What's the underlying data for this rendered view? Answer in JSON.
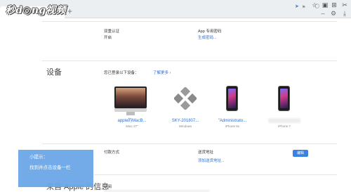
{
  "browser": {
    "new_tab_label": "+",
    "address_icons": [
      "send-icon",
      "flag-icon"
    ],
    "toolbar_icons": [
      "star-icon",
      "window-icon",
      "grid-icon",
      "settings-icon",
      "scissors-icon",
      "download-icon"
    ],
    "window_controls": [
      "minimize-icon",
      "maximize-icon",
      "close-icon"
    ]
  },
  "watermark": "秒d◎ng视频",
  "security": {
    "two_factor_label": "双重认证",
    "two_factor_value": "开启",
    "app_password_label": "App 专用密码",
    "app_password_link": "生成密码..."
  },
  "devices": {
    "title": "设备",
    "description": "您已登录以下设备：",
    "learn_more": "了解更多 ›",
    "items": [
      {
        "name": "apple的MacB...",
        "model": "iMac 27\"",
        "kind": "imac"
      },
      {
        "name": "SKY-201807...",
        "model": "Windows",
        "kind": "windows"
      },
      {
        "name": "\"Administrato...",
        "model": "iPhone 6s",
        "kind": "iphone"
      },
      {
        "name": "",
        "model": "iPhone 7",
        "kind": "iphone"
      }
    ]
  },
  "payment": {
    "method_label": "付款方式",
    "shipping_label": "送货地址",
    "add_shipping_link": "添加送货地址...",
    "edit_button": "编辑"
  },
  "from_apple": {
    "title": "来自 Apple 的信息",
    "subscribe_label": "订阅"
  },
  "tip": {
    "title": "小提示：",
    "body": "找到并点击设备一栏"
  }
}
